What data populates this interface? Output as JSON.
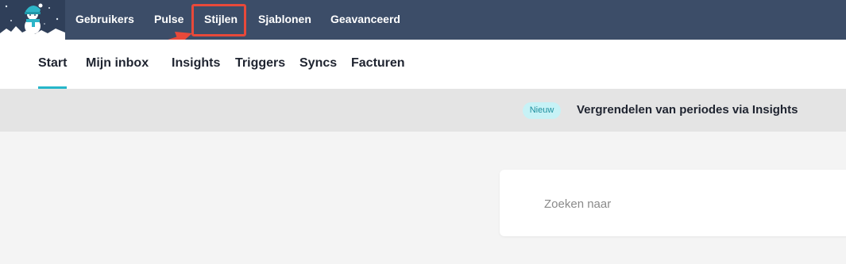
{
  "colors": {
    "topbar_bg": "#3c4d68",
    "accent": "#26b6c9",
    "highlight": "#e8493a",
    "badge_bg": "#c7f2f6"
  },
  "logo": {
    "icon": "snowman-logo-icon"
  },
  "topnav": {
    "items": [
      {
        "label": "Gebruikers"
      },
      {
        "label": "Pulse"
      },
      {
        "label": "Stijlen"
      },
      {
        "label": "Sjablonen"
      },
      {
        "label": "Geavanceerd"
      }
    ]
  },
  "subnav": {
    "active": "Start",
    "items": [
      {
        "label": "Start"
      },
      {
        "label": "Mijn inbox"
      },
      {
        "label": "Insights"
      },
      {
        "label": "Triggers"
      },
      {
        "label": "Syncs"
      },
      {
        "label": "Facturen"
      }
    ]
  },
  "banner": {
    "badge": "Nieuw",
    "text": "Vergrendelen van periodes via Insights"
  },
  "search": {
    "placeholder": "Zoeken naar"
  }
}
